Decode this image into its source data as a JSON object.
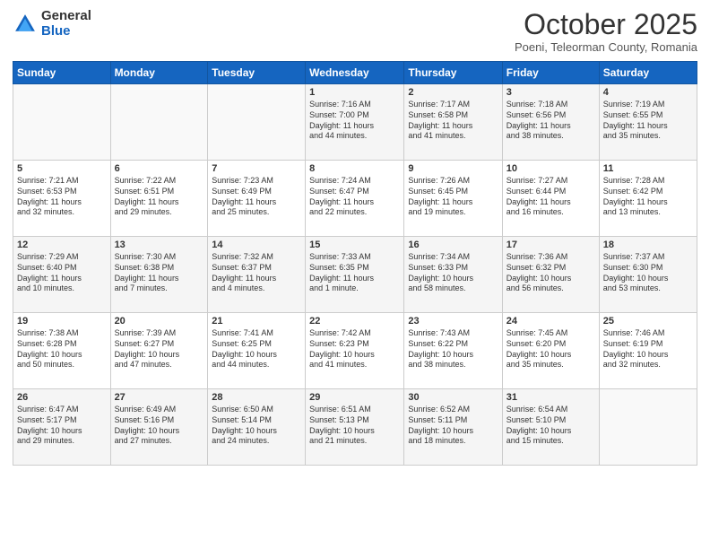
{
  "header": {
    "logo_general": "General",
    "logo_blue": "Blue",
    "month_title": "October 2025",
    "subtitle": "Poeni, Teleorman County, Romania"
  },
  "weekdays": [
    "Sunday",
    "Monday",
    "Tuesday",
    "Wednesday",
    "Thursday",
    "Friday",
    "Saturday"
  ],
  "weeks": [
    [
      {
        "day": "",
        "info": ""
      },
      {
        "day": "",
        "info": ""
      },
      {
        "day": "",
        "info": ""
      },
      {
        "day": "1",
        "info": "Sunrise: 7:16 AM\nSunset: 7:00 PM\nDaylight: 11 hours\nand 44 minutes."
      },
      {
        "day": "2",
        "info": "Sunrise: 7:17 AM\nSunset: 6:58 PM\nDaylight: 11 hours\nand 41 minutes."
      },
      {
        "day": "3",
        "info": "Sunrise: 7:18 AM\nSunset: 6:56 PM\nDaylight: 11 hours\nand 38 minutes."
      },
      {
        "day": "4",
        "info": "Sunrise: 7:19 AM\nSunset: 6:55 PM\nDaylight: 11 hours\nand 35 minutes."
      }
    ],
    [
      {
        "day": "5",
        "info": "Sunrise: 7:21 AM\nSunset: 6:53 PM\nDaylight: 11 hours\nand 32 minutes."
      },
      {
        "day": "6",
        "info": "Sunrise: 7:22 AM\nSunset: 6:51 PM\nDaylight: 11 hours\nand 29 minutes."
      },
      {
        "day": "7",
        "info": "Sunrise: 7:23 AM\nSunset: 6:49 PM\nDaylight: 11 hours\nand 25 minutes."
      },
      {
        "day": "8",
        "info": "Sunrise: 7:24 AM\nSunset: 6:47 PM\nDaylight: 11 hours\nand 22 minutes."
      },
      {
        "day": "9",
        "info": "Sunrise: 7:26 AM\nSunset: 6:45 PM\nDaylight: 11 hours\nand 19 minutes."
      },
      {
        "day": "10",
        "info": "Sunrise: 7:27 AM\nSunset: 6:44 PM\nDaylight: 11 hours\nand 16 minutes."
      },
      {
        "day": "11",
        "info": "Sunrise: 7:28 AM\nSunset: 6:42 PM\nDaylight: 11 hours\nand 13 minutes."
      }
    ],
    [
      {
        "day": "12",
        "info": "Sunrise: 7:29 AM\nSunset: 6:40 PM\nDaylight: 11 hours\nand 10 minutes."
      },
      {
        "day": "13",
        "info": "Sunrise: 7:30 AM\nSunset: 6:38 PM\nDaylight: 11 hours\nand 7 minutes."
      },
      {
        "day": "14",
        "info": "Sunrise: 7:32 AM\nSunset: 6:37 PM\nDaylight: 11 hours\nand 4 minutes."
      },
      {
        "day": "15",
        "info": "Sunrise: 7:33 AM\nSunset: 6:35 PM\nDaylight: 11 hours\nand 1 minute."
      },
      {
        "day": "16",
        "info": "Sunrise: 7:34 AM\nSunset: 6:33 PM\nDaylight: 10 hours\nand 58 minutes."
      },
      {
        "day": "17",
        "info": "Sunrise: 7:36 AM\nSunset: 6:32 PM\nDaylight: 10 hours\nand 56 minutes."
      },
      {
        "day": "18",
        "info": "Sunrise: 7:37 AM\nSunset: 6:30 PM\nDaylight: 10 hours\nand 53 minutes."
      }
    ],
    [
      {
        "day": "19",
        "info": "Sunrise: 7:38 AM\nSunset: 6:28 PM\nDaylight: 10 hours\nand 50 minutes."
      },
      {
        "day": "20",
        "info": "Sunrise: 7:39 AM\nSunset: 6:27 PM\nDaylight: 10 hours\nand 47 minutes."
      },
      {
        "day": "21",
        "info": "Sunrise: 7:41 AM\nSunset: 6:25 PM\nDaylight: 10 hours\nand 44 minutes."
      },
      {
        "day": "22",
        "info": "Sunrise: 7:42 AM\nSunset: 6:23 PM\nDaylight: 10 hours\nand 41 minutes."
      },
      {
        "day": "23",
        "info": "Sunrise: 7:43 AM\nSunset: 6:22 PM\nDaylight: 10 hours\nand 38 minutes."
      },
      {
        "day": "24",
        "info": "Sunrise: 7:45 AM\nSunset: 6:20 PM\nDaylight: 10 hours\nand 35 minutes."
      },
      {
        "day": "25",
        "info": "Sunrise: 7:46 AM\nSunset: 6:19 PM\nDaylight: 10 hours\nand 32 minutes."
      }
    ],
    [
      {
        "day": "26",
        "info": "Sunrise: 6:47 AM\nSunset: 5:17 PM\nDaylight: 10 hours\nand 29 minutes."
      },
      {
        "day": "27",
        "info": "Sunrise: 6:49 AM\nSunset: 5:16 PM\nDaylight: 10 hours\nand 27 minutes."
      },
      {
        "day": "28",
        "info": "Sunrise: 6:50 AM\nSunset: 5:14 PM\nDaylight: 10 hours\nand 24 minutes."
      },
      {
        "day": "29",
        "info": "Sunrise: 6:51 AM\nSunset: 5:13 PM\nDaylight: 10 hours\nand 21 minutes."
      },
      {
        "day": "30",
        "info": "Sunrise: 6:52 AM\nSunset: 5:11 PM\nDaylight: 10 hours\nand 18 minutes."
      },
      {
        "day": "31",
        "info": "Sunrise: 6:54 AM\nSunset: 5:10 PM\nDaylight: 10 hours\nand 15 minutes."
      },
      {
        "day": "",
        "info": ""
      }
    ]
  ]
}
